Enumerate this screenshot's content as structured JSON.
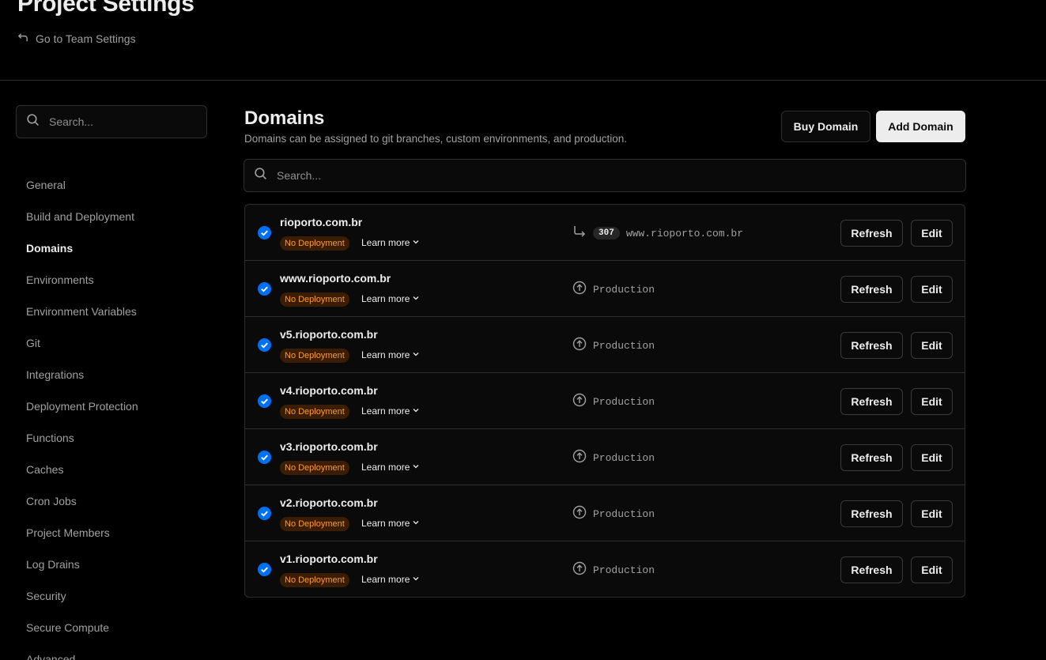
{
  "header": {
    "title": "Project Settings",
    "back_link": "Go to Team Settings"
  },
  "sidebar": {
    "search_placeholder": "Search...",
    "items": [
      {
        "label": "General"
      },
      {
        "label": "Build and Deployment"
      },
      {
        "label": "Domains",
        "active": true
      },
      {
        "label": "Environments"
      },
      {
        "label": "Environment Variables"
      },
      {
        "label": "Git"
      },
      {
        "label": "Integrations"
      },
      {
        "label": "Deployment Protection"
      },
      {
        "label": "Functions"
      },
      {
        "label": "Caches"
      },
      {
        "label": "Cron Jobs"
      },
      {
        "label": "Project Members"
      },
      {
        "label": "Log Drains"
      },
      {
        "label": "Security"
      },
      {
        "label": "Secure Compute"
      },
      {
        "label": "Advanced"
      }
    ]
  },
  "main": {
    "title": "Domains",
    "description": "Domains can be assigned to git branches, custom environments, and production.",
    "buy_label": "Buy Domain",
    "add_label": "Add Domain",
    "search_placeholder": "Search...",
    "refresh_label": "Refresh",
    "edit_label": "Edit",
    "badge_label": "No Deployment",
    "learn_more_label": "Learn more",
    "colors": {
      "accent_check": "#0070f3",
      "warning_badge": "#ff9a2e"
    },
    "domains": [
      {
        "name": "rioporto.com.br",
        "type": "redirect",
        "redirect_code": "307",
        "target": "www.rioporto.com.br"
      },
      {
        "name": "www.rioporto.com.br",
        "type": "environment",
        "target": "Production"
      },
      {
        "name": "v5.rioporto.com.br",
        "type": "environment",
        "target": "Production"
      },
      {
        "name": "v4.rioporto.com.br",
        "type": "environment",
        "target": "Production"
      },
      {
        "name": "v3.rioporto.com.br",
        "type": "environment",
        "target": "Production"
      },
      {
        "name": "v2.rioporto.com.br",
        "type": "environment",
        "target": "Production"
      },
      {
        "name": "v1.rioporto.com.br",
        "type": "environment",
        "target": "Production"
      }
    ]
  }
}
